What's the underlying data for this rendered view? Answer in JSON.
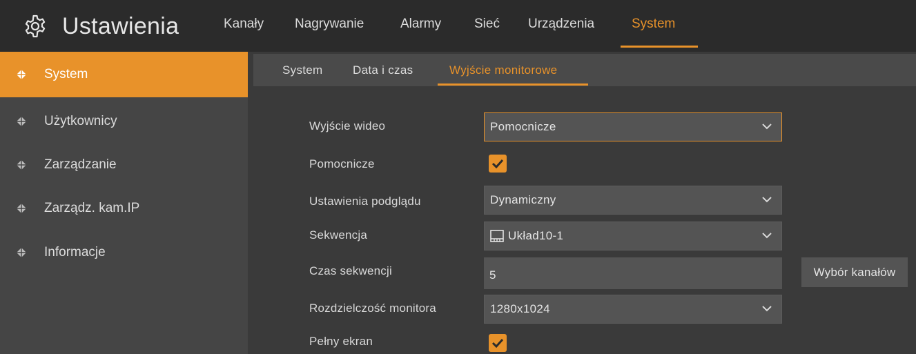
{
  "header": {
    "title": "Ustawienia",
    "tabs": [
      {
        "label": "Kanały"
      },
      {
        "label": "Nagrywanie"
      },
      {
        "label": "Alarmy"
      },
      {
        "label": "Sieć"
      },
      {
        "label": "Urządzenia"
      },
      {
        "label": "System"
      }
    ],
    "active_tab": "System"
  },
  "sidebar": {
    "items": [
      {
        "label": "System",
        "icon": "diamond-icon"
      },
      {
        "label": "Użytkownicy",
        "icon": "diamond-icon"
      },
      {
        "label": "Zarządzanie",
        "icon": "diamond-icon"
      },
      {
        "label": "Zarządz. kam.IP",
        "icon": "diamond-icon"
      },
      {
        "label": "Informacje",
        "icon": "diamond-icon"
      }
    ],
    "active_item": "System"
  },
  "subtabs": {
    "items": [
      {
        "label": "System"
      },
      {
        "label": "Data i czas"
      },
      {
        "label": "Wyjście monitorowe"
      }
    ],
    "active": "Wyjście monitorowe"
  },
  "form": {
    "video_output": {
      "label": "Wyjście wideo",
      "value": "Pomocnicze"
    },
    "auxiliary": {
      "label": "Pomocnicze",
      "checked": true
    },
    "preview_settings": {
      "label": "Ustawienia podglądu",
      "value": "Dynamiczny"
    },
    "sequence": {
      "label": "Sekwencja",
      "value": "Układ10-1",
      "icon": "layout-icon"
    },
    "sequence_time": {
      "label": "Czas sekwencji",
      "value": "5"
    },
    "channel_select_button": "Wybór kanałów",
    "monitor_resolution": {
      "label": "Rozdzielczość monitora",
      "value": "1280x1024"
    },
    "fullscreen": {
      "label": "Pełny ekran",
      "checked": true
    }
  },
  "colors": {
    "accent": "#e8922a",
    "header_bg": "#2b2b2b",
    "sidebar_bg": "#454545",
    "content_bg": "#3a3a3a",
    "control_bg": "#545454"
  }
}
